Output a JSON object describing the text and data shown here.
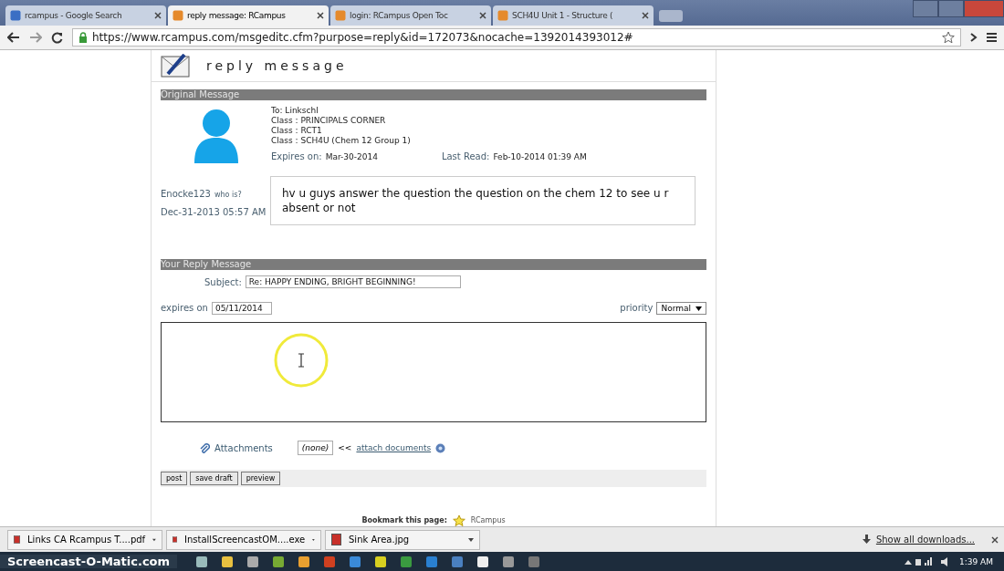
{
  "browser": {
    "tabs": [
      {
        "label": "rcampus - Google Search",
        "selected": false
      },
      {
        "label": "reply message: RCampus",
        "selected": true
      },
      {
        "label": "login: RCampus Open Toc",
        "selected": false
      },
      {
        "label": "SCH4U Unit 1 - Structure (",
        "selected": false
      }
    ],
    "url": "https://www.rcampus.com/msgeditc.cfm?purpose=reply&id=172073&nocache=1392014393012#"
  },
  "page": {
    "title": "reply message",
    "original_message": {
      "header": "Original Message",
      "recipients": [
        "To: Linkschl",
        "Class : PRINCIPALS CORNER",
        "Class : RCT1",
        "Class : SCH4U (Chem 12 Group 1)"
      ],
      "expires_label": "Expires on:",
      "expires_value": "Mar-30-2014",
      "last_read_label": "Last Read:",
      "last_read_value": "Feb-10-2014 01:39 AM",
      "sender": "Enocke123",
      "who_is": "who is?",
      "date": "Dec-31-2013 05:57 AM",
      "body": "hv u guys answer the question the question on the chem 12 to see u r absent or not"
    },
    "reply": {
      "header": "Your Reply Message",
      "subject_label": "Subject:",
      "subject_value": "Re: HAPPY ENDING, BRIGHT BEGINNING!",
      "expires_label": "expires on",
      "expires_value": "05/11/2014",
      "priority_label": "priority",
      "priority_value": "Normal",
      "attachments_label": "Attachments",
      "attachments_value": "(none)",
      "arrows": "<<",
      "attach_link": "attach documents",
      "buttons": [
        "post",
        "save draft",
        "preview"
      ]
    },
    "bookmark": {
      "label": "Bookmark this page:",
      "site": "RCampus"
    }
  },
  "downloads": {
    "items": [
      {
        "name": "Links CA Rcampus T....pdf"
      },
      {
        "name": "InstallScreencastOM....exe"
      },
      {
        "name": "Sink Area.jpg"
      }
    ],
    "show_all": "Show all downloads..."
  },
  "taskbar": {
    "brand": "Screencast-O-Matic.com",
    "time": "1:39 AM"
  }
}
